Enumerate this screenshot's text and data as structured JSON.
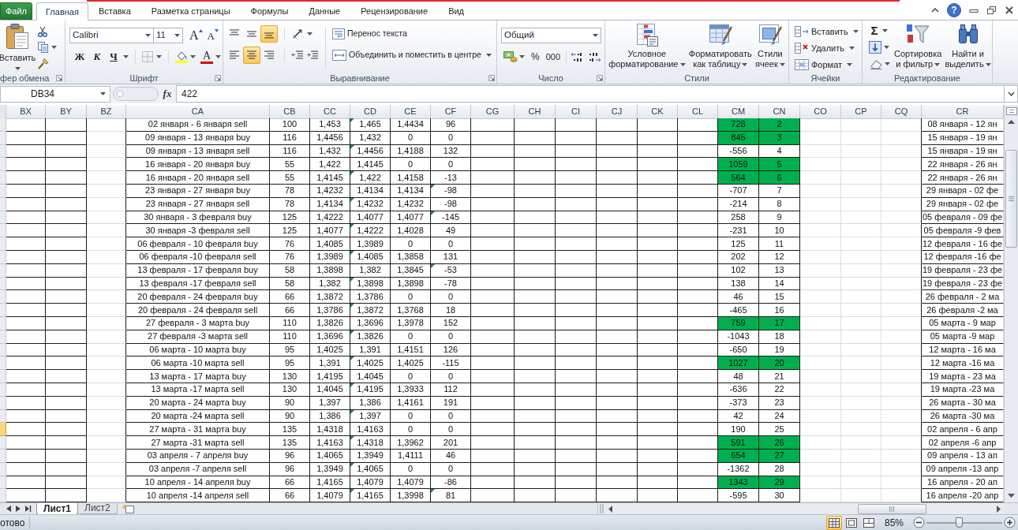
{
  "file_button": "Файл",
  "tabs": [
    {
      "label": "Главная",
      "selected": true
    },
    {
      "label": "Вставка",
      "selected": false
    },
    {
      "label": "Разметка страницы",
      "selected": false
    },
    {
      "label": "Формулы",
      "selected": false
    },
    {
      "label": "Данные",
      "selected": false
    },
    {
      "label": "Рецензирование",
      "selected": false
    },
    {
      "label": "Вид",
      "selected": false
    }
  ],
  "help_button": "?",
  "ribbon": {
    "clipboard": {
      "label": "фер обмена",
      "paste": "Вставить"
    },
    "font": {
      "label": "Шрифт",
      "font_name": "Calibri",
      "font_size": "11",
      "grow": "A",
      "shrink": "A",
      "bold": "Ж",
      "italic": "К",
      "underline": "Ч",
      "font_color": "A"
    },
    "alignment": {
      "label": "Выравнивание",
      "vertical": [
        {
          "kind": "top",
          "selected": false
        },
        {
          "kind": "middle",
          "selected": false
        },
        {
          "kind": "bottom",
          "selected": true
        }
      ],
      "horizontal": [
        {
          "kind": "left",
          "selected": false
        },
        {
          "kind": "center",
          "selected": true
        },
        {
          "kind": "right",
          "selected": false
        }
      ],
      "wrap_text": "Перенос текста",
      "merge": "Объединить и поместить в центре"
    },
    "number": {
      "label": "Число",
      "format": "Общий",
      "percent": "%",
      "thousands": "000"
    },
    "styles": {
      "label": "Стили",
      "buttons": [
        {
          "kind": "conditional",
          "label": "Условное\nформатирование"
        },
        {
          "kind": "table",
          "label": "Форматировать\nкак таблицу"
        },
        {
          "kind": "cell_styles",
          "label": "Стили\nячеек"
        }
      ]
    },
    "cells": {
      "label": "Ячейки",
      "buttons": [
        {
          "kind": "insert",
          "label": "Вставить"
        },
        {
          "kind": "delete",
          "label": "Удалить"
        },
        {
          "kind": "format",
          "label": "Формат"
        }
      ]
    },
    "editing": {
      "label": "Редактирование",
      "sum": "Σ",
      "buttons": [
        {
          "kind": "sort",
          "label": "Сортировка\nи фильтр"
        },
        {
          "kind": "find",
          "label": "Найти и\nвыделить"
        }
      ]
    }
  },
  "formula_bar": {
    "name_box": "DB34",
    "fx": "fx",
    "value": "422"
  },
  "sheet": {
    "columns": [
      "BX",
      "BY",
      "BZ",
      "CA",
      "CB",
      "CC",
      "CD",
      "CE",
      "CF",
      "CG",
      "CH",
      "CI",
      "CJ",
      "CK",
      "CL",
      "CM",
      "CN",
      "CO",
      "CP",
      "CQ",
      "CR"
    ],
    "rows": [
      {
        "selected": false,
        "highlighted": true,
        "cells": [
          "",
          "",
          "",
          "02 января - 6 января sell",
          "100",
          "1,453",
          "1,465",
          "1,4434",
          "96",
          "",
          "",
          "",
          "",
          "",
          "",
          "728",
          "2",
          "",
          "",
          "",
          "08 января - 12 ян"
        ],
        "marked": [
          false,
          false,
          false,
          false,
          false,
          false,
          true,
          false,
          false,
          false,
          false,
          false,
          false,
          false,
          false,
          false,
          false,
          false,
          false,
          false,
          false
        ]
      },
      {
        "selected": false,
        "highlighted": true,
        "cells": [
          "",
          "",
          "",
          "09 января - 13 января buy",
          "116",
          "1,4456",
          "1,432",
          "0",
          "0",
          "",
          "",
          "",
          "",
          "",
          "",
          "845",
          "3",
          "",
          "",
          "",
          "15 января - 19 ян"
        ],
        "marked": [
          false,
          false,
          false,
          false,
          false,
          false,
          false,
          false,
          false,
          false,
          false,
          false,
          false,
          false,
          false,
          false,
          false,
          false,
          false,
          false,
          false
        ]
      },
      {
        "selected": false,
        "highlighted": false,
        "cells": [
          "",
          "",
          "",
          "09 января - 13 января sell",
          "116",
          "1,432",
          "1,4456",
          "1,4188",
          "132",
          "",
          "",
          "",
          "",
          "",
          "",
          "-556",
          "4",
          "",
          "",
          "",
          "15 января - 19 ян"
        ],
        "marked": [
          false,
          false,
          false,
          false,
          false,
          false,
          true,
          false,
          false,
          false,
          false,
          false,
          false,
          false,
          false,
          false,
          false,
          false,
          false,
          false,
          false
        ]
      },
      {
        "selected": false,
        "highlighted": true,
        "cells": [
          "",
          "",
          "",
          "16 января - 20 января buy",
          "55",
          "1,422",
          "1,4145",
          "0",
          "0",
          "",
          "",
          "",
          "",
          "",
          "",
          "1059",
          "5",
          "",
          "",
          "",
          "22 января - 26 ян"
        ],
        "marked": [
          false,
          false,
          false,
          false,
          false,
          false,
          false,
          false,
          false,
          false,
          false,
          false,
          false,
          false,
          false,
          false,
          false,
          false,
          false,
          false,
          false
        ]
      },
      {
        "selected": false,
        "highlighted": true,
        "cells": [
          "",
          "",
          "",
          "16 января - 20 января sell",
          "55",
          "1,4145",
          "1,422",
          "1,4158",
          "-13",
          "",
          "",
          "",
          "",
          "",
          "",
          "564",
          "6",
          "",
          "",
          "",
          "22 января - 26 ян"
        ],
        "marked": [
          false,
          false,
          false,
          false,
          false,
          false,
          true,
          false,
          false,
          false,
          false,
          false,
          false,
          false,
          false,
          false,
          false,
          false,
          false,
          false,
          false
        ]
      },
      {
        "selected": false,
        "highlighted": false,
        "cells": [
          "",
          "",
          "",
          "23 января - 27 января buy",
          "78",
          "1,4232",
          "1,4134",
          "1,4134",
          "-98",
          "",
          "",
          "",
          "",
          "",
          "",
          "-707",
          "7",
          "",
          "",
          "",
          "29 января - 02 фе"
        ],
        "marked": [
          false,
          false,
          false,
          false,
          false,
          false,
          false,
          false,
          true,
          false,
          false,
          false,
          false,
          false,
          false,
          false,
          false,
          false,
          false,
          false,
          false
        ]
      },
      {
        "selected": false,
        "highlighted": false,
        "cells": [
          "",
          "",
          "",
          "23 января - 27 января sell",
          "78",
          "1,4134",
          "1,4232",
          "1,4232",
          "-98",
          "",
          "",
          "",
          "",
          "",
          "",
          "-214",
          "8",
          "",
          "",
          "",
          "29 января - 02 фе"
        ],
        "marked": [
          false,
          false,
          false,
          false,
          false,
          false,
          true,
          false,
          false,
          false,
          false,
          false,
          false,
          false,
          false,
          false,
          false,
          false,
          false,
          false,
          false
        ]
      },
      {
        "selected": false,
        "highlighted": false,
        "cells": [
          "",
          "",
          "",
          "30 января - 3 февраля buy",
          "125",
          "1,4222",
          "1,4077",
          "1,4077",
          "-145",
          "",
          "",
          "",
          "",
          "",
          "",
          "258",
          "9",
          "",
          "",
          "",
          "05 февраля - 09 фе"
        ],
        "marked": [
          false,
          false,
          false,
          false,
          false,
          false,
          false,
          false,
          true,
          false,
          false,
          false,
          false,
          false,
          false,
          false,
          false,
          false,
          false,
          false,
          false
        ]
      },
      {
        "selected": false,
        "highlighted": false,
        "cells": [
          "",
          "",
          "",
          "30 января -3 февраля sell",
          "125",
          "1,4077",
          "1,4222",
          "1,4028",
          "49",
          "",
          "",
          "",
          "",
          "",
          "",
          "-231",
          "10",
          "",
          "",
          "",
          "05 февраля -9 фев"
        ],
        "marked": [
          false,
          false,
          false,
          false,
          false,
          false,
          true,
          false,
          false,
          false,
          false,
          false,
          false,
          false,
          false,
          false,
          false,
          false,
          false,
          false,
          false
        ]
      },
      {
        "selected": false,
        "highlighted": false,
        "cells": [
          "",
          "",
          "",
          "06 февраля - 10 февраля buy",
          "76",
          "1,4085",
          "1,3989",
          "0",
          "0",
          "",
          "",
          "",
          "",
          "",
          "",
          "125",
          "11",
          "",
          "",
          "",
          "12 февраля - 16 фе"
        ],
        "marked": [
          false,
          false,
          false,
          false,
          false,
          false,
          false,
          false,
          false,
          false,
          false,
          false,
          false,
          false,
          false,
          false,
          false,
          false,
          false,
          false,
          false
        ]
      },
      {
        "selected": false,
        "highlighted": false,
        "cells": [
          "",
          "",
          "",
          "06 февраля -10 февраля sell",
          "76",
          "1,3989",
          "1,4085",
          "1,3858",
          "131",
          "",
          "",
          "",
          "",
          "",
          "",
          "202",
          "12",
          "",
          "",
          "",
          "12 февраля -16 фе"
        ],
        "marked": [
          false,
          false,
          false,
          false,
          false,
          false,
          true,
          false,
          false,
          false,
          false,
          false,
          false,
          false,
          false,
          false,
          false,
          false,
          false,
          false,
          false
        ]
      },
      {
        "selected": false,
        "highlighted": false,
        "cells": [
          "",
          "",
          "",
          "13 февраля - 17 февраля buy",
          "58",
          "1,3898",
          "1,382",
          "1,3845",
          "-53",
          "",
          "",
          "",
          "",
          "",
          "",
          "102",
          "13",
          "",
          "",
          "",
          "19 февраля - 23 фе"
        ],
        "marked": [
          false,
          false,
          false,
          false,
          false,
          false,
          false,
          false,
          true,
          false,
          false,
          false,
          false,
          false,
          false,
          false,
          false,
          false,
          false,
          false,
          false
        ]
      },
      {
        "selected": false,
        "highlighted": false,
        "cells": [
          "",
          "",
          "",
          "13 февраля -17 февраля sell",
          "58",
          "1,382",
          "1,3898",
          "1,3898",
          "-78",
          "",
          "",
          "",
          "",
          "",
          "",
          "138",
          "14",
          "",
          "",
          "",
          "19 февраля - 23 фе"
        ],
        "marked": [
          false,
          false,
          false,
          false,
          false,
          false,
          true,
          false,
          false,
          false,
          false,
          false,
          false,
          false,
          false,
          false,
          false,
          false,
          false,
          false,
          false
        ]
      },
      {
        "selected": false,
        "highlighted": false,
        "cells": [
          "",
          "",
          "",
          "20 февраля - 24 февраля buy",
          "66",
          "1,3872",
          "1,3786",
          "0",
          "0",
          "",
          "",
          "",
          "",
          "",
          "",
          "46",
          "15",
          "",
          "",
          "",
          "26 февраля - 2 ма"
        ],
        "marked": [
          false,
          false,
          false,
          false,
          false,
          false,
          false,
          false,
          false,
          false,
          false,
          false,
          false,
          false,
          false,
          false,
          false,
          false,
          false,
          false,
          false
        ]
      },
      {
        "selected": false,
        "highlighted": false,
        "cells": [
          "",
          "",
          "",
          "20 февраля - 24 февраля sell",
          "66",
          "1,3786",
          "1,3872",
          "1,3768",
          "18",
          "",
          "",
          "",
          "",
          "",
          "",
          "-465",
          "16",
          "",
          "",
          "",
          "26 февраля -2 ма"
        ],
        "marked": [
          false,
          false,
          false,
          false,
          false,
          false,
          true,
          false,
          false,
          false,
          false,
          false,
          false,
          false,
          false,
          false,
          false,
          false,
          false,
          false,
          false
        ]
      },
      {
        "selected": false,
        "highlighted": true,
        "cells": [
          "",
          "",
          "",
          "27 февраля - 3 марта buy",
          "110",
          "1,3826",
          "1,3696",
          "1,3978",
          "152",
          "",
          "",
          "",
          "",
          "",
          "",
          "759",
          "17",
          "",
          "",
          "",
          "05 марта - 9 мар"
        ],
        "marked": [
          false,
          false,
          false,
          false,
          false,
          false,
          false,
          false,
          false,
          false,
          false,
          false,
          false,
          false,
          false,
          false,
          false,
          false,
          false,
          false,
          false
        ]
      },
      {
        "selected": false,
        "highlighted": false,
        "cells": [
          "",
          "",
          "",
          "27 февраля -3 марта sell",
          "110",
          "1,3696",
          "1,3826",
          "0",
          "0",
          "",
          "",
          "",
          "",
          "",
          "",
          "-1043",
          "18",
          "",
          "",
          "",
          "05 марта -9 мар"
        ],
        "marked": [
          false,
          false,
          false,
          false,
          false,
          false,
          true,
          false,
          false,
          false,
          false,
          false,
          false,
          false,
          false,
          false,
          false,
          false,
          false,
          false,
          false
        ]
      },
      {
        "selected": false,
        "highlighted": false,
        "cells": [
          "",
          "",
          "",
          "06 марта - 10 марта buy",
          "95",
          "1,4025",
          "1,391",
          "1,4151",
          "126",
          "",
          "",
          "",
          "",
          "",
          "",
          "-650",
          "19",
          "",
          "",
          "",
          "12 марта - 16 ма"
        ],
        "marked": [
          false,
          false,
          false,
          false,
          false,
          false,
          false,
          false,
          false,
          false,
          false,
          false,
          false,
          false,
          false,
          false,
          false,
          false,
          false,
          false,
          false
        ]
      },
      {
        "selected": false,
        "highlighted": true,
        "cells": [
          "",
          "",
          "",
          "06 марта -10 марта sell",
          "95",
          "1,391",
          "1,4025",
          "1,4025",
          "-115",
          "",
          "",
          "",
          "",
          "",
          "",
          "1027",
          "20",
          "",
          "",
          "",
          "12 марта -16 ма"
        ],
        "marked": [
          false,
          false,
          false,
          false,
          false,
          false,
          true,
          false,
          false,
          false,
          false,
          false,
          false,
          false,
          false,
          false,
          false,
          false,
          false,
          false,
          false
        ]
      },
      {
        "selected": false,
        "highlighted": false,
        "cells": [
          "",
          "",
          "",
          "13 марта - 17 марта buy",
          "130",
          "1,4195",
          "1,4045",
          "0",
          "0",
          "",
          "",
          "",
          "",
          "",
          "",
          "48",
          "21",
          "",
          "",
          "",
          "19 марта - 23 ма"
        ],
        "marked": [
          false,
          false,
          false,
          false,
          false,
          false,
          false,
          false,
          false,
          false,
          false,
          false,
          false,
          false,
          false,
          false,
          false,
          false,
          false,
          false,
          false
        ]
      },
      {
        "selected": false,
        "highlighted": false,
        "cells": [
          "",
          "",
          "",
          "13 марта -17 марта sell",
          "130",
          "1,4045",
          "1,4195",
          "1,3933",
          "112",
          "",
          "",
          "",
          "",
          "",
          "",
          "-636",
          "22",
          "",
          "",
          "",
          "19 марта -23 ма"
        ],
        "marked": [
          false,
          false,
          false,
          false,
          false,
          false,
          true,
          false,
          false,
          false,
          false,
          false,
          false,
          false,
          false,
          false,
          false,
          false,
          false,
          false,
          false
        ]
      },
      {
        "selected": false,
        "highlighted": false,
        "cells": [
          "",
          "",
          "",
          "20 марта - 24 марта buy",
          "90",
          "1,397",
          "1,386",
          "1,4161",
          "191",
          "",
          "",
          "",
          "",
          "",
          "",
          "-373",
          "23",
          "",
          "",
          "",
          "26 марта - 30 ма"
        ],
        "marked": [
          false,
          false,
          false,
          false,
          false,
          false,
          false,
          false,
          false,
          false,
          false,
          false,
          false,
          false,
          false,
          false,
          false,
          false,
          false,
          false,
          false
        ]
      },
      {
        "selected": false,
        "highlighted": false,
        "cells": [
          "",
          "",
          "",
          "20 марта -24 марта sell",
          "90",
          "1,386",
          "1,397",
          "0",
          "0",
          "",
          "",
          "",
          "",
          "",
          "",
          "42",
          "24",
          "",
          "",
          "",
          "26 марта -30 ма"
        ],
        "marked": [
          false,
          false,
          false,
          false,
          false,
          false,
          true,
          false,
          false,
          false,
          false,
          false,
          false,
          false,
          false,
          false,
          false,
          false,
          false,
          false,
          false
        ]
      },
      {
        "selected": true,
        "highlighted": false,
        "cells": [
          "",
          "",
          "",
          "27 марта - 31 марта buy",
          "135",
          "1,4318",
          "1,4163",
          "0",
          "0",
          "",
          "",
          "",
          "",
          "",
          "",
          "190",
          "25",
          "",
          "",
          "",
          "02 апреля - 6 апр"
        ],
        "marked": [
          false,
          false,
          false,
          false,
          false,
          false,
          false,
          false,
          false,
          false,
          false,
          false,
          false,
          false,
          false,
          false,
          false,
          false,
          false,
          false,
          false
        ]
      },
      {
        "selected": false,
        "highlighted": true,
        "cells": [
          "",
          "",
          "",
          "27 марта -31 марта sell",
          "135",
          "1,4163",
          "1,4318",
          "1,3962",
          "201",
          "",
          "",
          "",
          "",
          "",
          "",
          "591",
          "26",
          "",
          "",
          "",
          "02 апреля -6 апр"
        ],
        "marked": [
          false,
          false,
          false,
          false,
          false,
          false,
          true,
          false,
          false,
          false,
          false,
          false,
          false,
          false,
          false,
          false,
          false,
          false,
          false,
          false,
          false
        ]
      },
      {
        "selected": false,
        "highlighted": true,
        "cells": [
          "",
          "",
          "",
          "03 апреля - 7 апреля buy",
          "96",
          "1,4065",
          "1,3949",
          "1,4111",
          "46",
          "",
          "",
          "",
          "",
          "",
          "",
          "654",
          "27",
          "",
          "",
          "",
          "09 апреля - 13 ап"
        ],
        "marked": [
          false,
          false,
          false,
          false,
          false,
          false,
          false,
          false,
          false,
          false,
          false,
          false,
          false,
          false,
          false,
          false,
          false,
          false,
          false,
          false,
          false
        ]
      },
      {
        "selected": false,
        "highlighted": false,
        "cells": [
          "",
          "",
          "",
          "03 апреля -7 апреля sell",
          "96",
          "1,3949",
          "1,4065",
          "0",
          "0",
          "",
          "",
          "",
          "",
          "",
          "",
          "-1362",
          "28",
          "",
          "",
          "",
          "09 апреля -13 апр"
        ],
        "marked": [
          false,
          false,
          false,
          false,
          false,
          false,
          true,
          false,
          false,
          false,
          false,
          false,
          false,
          false,
          false,
          false,
          false,
          false,
          false,
          false,
          false
        ]
      },
      {
        "selected": false,
        "highlighted": true,
        "cells": [
          "",
          "",
          "",
          "10 апреля - 14 апреля buy",
          "66",
          "1,4165",
          "1,4079",
          "1,4079",
          "-86",
          "",
          "",
          "",
          "",
          "",
          "",
          "1343",
          "29",
          "",
          "",
          "",
          "16 апреля - 20 ап"
        ],
        "marked": [
          false,
          false,
          false,
          false,
          false,
          false,
          false,
          false,
          false,
          false,
          false,
          false,
          false,
          false,
          false,
          false,
          false,
          false,
          false,
          false,
          false
        ]
      },
      {
        "selected": false,
        "highlighted": false,
        "cells": [
          "",
          "",
          "",
          "10 апреля -14 апреля sell",
          "66",
          "1,4079",
          "1,4165",
          "1,3998",
          "81",
          "",
          "",
          "",
          "",
          "",
          "",
          "-595",
          "30",
          "",
          "",
          "",
          "16 апреля -20 апр"
        ],
        "marked": [
          false,
          false,
          false,
          false,
          false,
          false,
          true,
          false,
          true,
          false,
          false,
          false,
          false,
          false,
          false,
          false,
          false,
          false,
          false,
          false,
          false
        ]
      }
    ]
  },
  "sheet_tabs": [
    {
      "label": "Лист1",
      "selected": true
    },
    {
      "label": "Лист2",
      "selected": false
    }
  ],
  "status_bar": {
    "status": "отово",
    "views": [
      {
        "kind": "normal",
        "selected": true
      },
      {
        "kind": "page_layout",
        "selected": false
      },
      {
        "kind": "page_break",
        "selected": false
      }
    ],
    "zoom": "85%",
    "zoom_slider": {
      "level": 0.43
    }
  }
}
